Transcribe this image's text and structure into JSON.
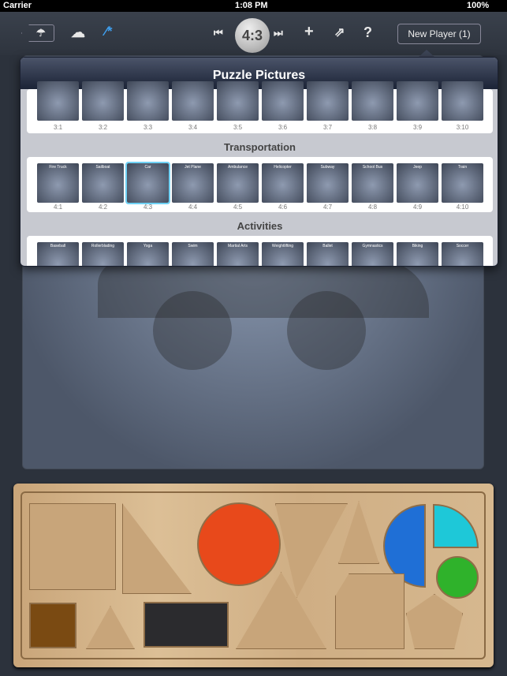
{
  "status": {
    "carrier": "Carrier",
    "time": "1:08 PM",
    "battery": "100%"
  },
  "toolbar": {
    "level": "4:3",
    "player": "New Player (1)",
    "icons": [
      "back-umbrella-icon",
      "cloud-icon",
      "magic-wand-icon",
      "skip-previous-icon",
      "skip-next-icon",
      "plus-icon",
      "share-icon",
      "help-icon"
    ],
    "accent": "#3fa0f0"
  },
  "popover": {
    "title": "Puzzle Pictures",
    "row3": {
      "labels": [
        "3:1",
        "3:2",
        "3:3",
        "3:4",
        "3:5",
        "3:6",
        "3:7",
        "3:8",
        "3:9",
        "3:10"
      ]
    },
    "transportation": {
      "title": "Transportation",
      "items": [
        {
          "name": "Fire Truck",
          "label": "4:1"
        },
        {
          "name": "Sailboat",
          "label": "4:2"
        },
        {
          "name": "Car",
          "label": "4:3"
        },
        {
          "name": "Jet Plane",
          "label": "4:4"
        },
        {
          "name": "Ambulance",
          "label": "4:5"
        },
        {
          "name": "Helicopter",
          "label": "4:6"
        },
        {
          "name": "Subway",
          "label": "4:7"
        },
        {
          "name": "School Bus",
          "label": "4:8"
        },
        {
          "name": "Jeep",
          "label": "4:9"
        },
        {
          "name": "Train",
          "label": "4:10"
        }
      ],
      "selected": "4:3"
    },
    "activities": {
      "title": "Activities",
      "items": [
        "Baseball",
        "Rollerblading",
        "Yoga",
        "Swim",
        "Martial Arts",
        "Weightlifting",
        "Ballet",
        "Gymnastics",
        "Biking",
        "Soccer"
      ]
    }
  },
  "board": {
    "colors": {
      "circle": "#e8491b",
      "half_circle": "#1f6fd6",
      "quarter": "#1ec8d8",
      "small_circle": "#2fb22b",
      "square": "#7a4a12",
      "rectangle": "#2b2b2e"
    }
  }
}
